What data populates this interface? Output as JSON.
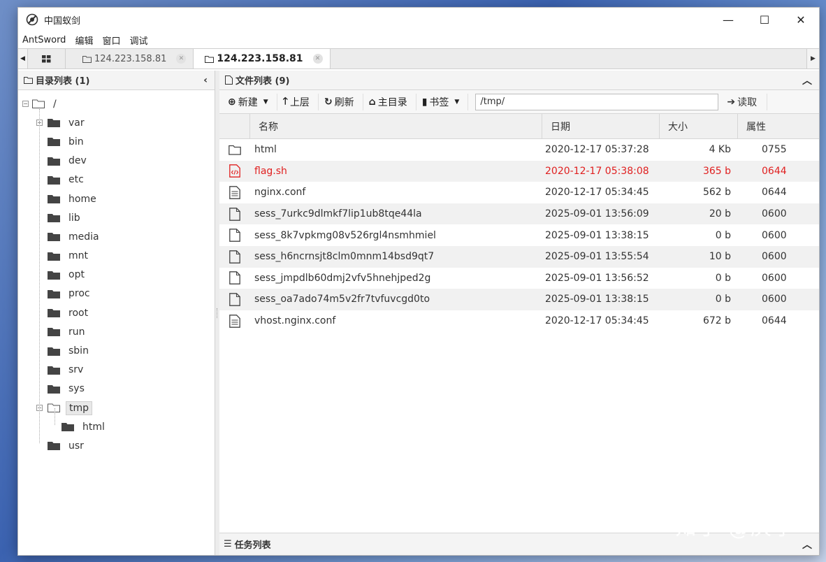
{
  "window": {
    "title": "中国蚁剑",
    "controls": {
      "minimize": "—",
      "maximize": "☐",
      "close": "✕"
    }
  },
  "menu": [
    "AntSword",
    "编辑",
    "窗口",
    "调试"
  ],
  "tabs": [
    {
      "label": "124.223.158.81",
      "active": false
    },
    {
      "label": "124.223.158.81",
      "active": true
    }
  ],
  "dir_panel": {
    "title": "目录列表 (1)",
    "tree": [
      {
        "label": "/",
        "depth": 0,
        "toggle": "minus",
        "open": true
      },
      {
        "label": "var",
        "depth": 1,
        "toggle": "plus"
      },
      {
        "label": "bin",
        "depth": 1
      },
      {
        "label": "dev",
        "depth": 1
      },
      {
        "label": "etc",
        "depth": 1
      },
      {
        "label": "home",
        "depth": 1
      },
      {
        "label": "lib",
        "depth": 1
      },
      {
        "label": "media",
        "depth": 1
      },
      {
        "label": "mnt",
        "depth": 1
      },
      {
        "label": "opt",
        "depth": 1
      },
      {
        "label": "proc",
        "depth": 1
      },
      {
        "label": "root",
        "depth": 1
      },
      {
        "label": "run",
        "depth": 1
      },
      {
        "label": "sbin",
        "depth": 1
      },
      {
        "label": "srv",
        "depth": 1
      },
      {
        "label": "sys",
        "depth": 1
      },
      {
        "label": "tmp",
        "depth": 1,
        "toggle": "minus",
        "open": true,
        "selected": true
      },
      {
        "label": "html",
        "depth": 2
      },
      {
        "label": "usr",
        "depth": 1
      }
    ]
  },
  "file_panel": {
    "title": "文件列表 (9)",
    "toolbar": {
      "new": "新建",
      "up": "上层",
      "refresh": "刷新",
      "home": "主目录",
      "bookmark": "书签",
      "path": "/tmp/",
      "read": "读取"
    },
    "columns": {
      "name": "名称",
      "date": "日期",
      "size": "大小",
      "attr": "属性"
    },
    "files": [
      {
        "type": "folder",
        "name": "html",
        "date": "2020-12-17 05:37:28",
        "size": "4 Kb",
        "attr": "0755"
      },
      {
        "type": "script",
        "name": "flag.sh",
        "date": "2020-12-17 05:38:08",
        "size": "365 b",
        "attr": "0644",
        "highlight": true
      },
      {
        "type": "text",
        "name": "nginx.conf",
        "date": "2020-12-17 05:34:45",
        "size": "562 b",
        "attr": "0644"
      },
      {
        "type": "file",
        "name": "sess_7urkc9dlmkf7lip1ub8tqe44la",
        "date": "2025-09-01 13:56:09",
        "size": "20 b",
        "attr": "0600"
      },
      {
        "type": "file",
        "name": "sess_8k7vpkmg08v526rgl4nsmhmiel",
        "date": "2025-09-01 13:38:15",
        "size": "0 b",
        "attr": "0600"
      },
      {
        "type": "file",
        "name": "sess_h6ncrnsjt8clm0mnm14bsd9qt7",
        "date": "2025-09-01 13:55:54",
        "size": "10 b",
        "attr": "0600"
      },
      {
        "type": "file",
        "name": "sess_jmpdlb60dmj2vfv5hnehjped2g",
        "date": "2025-09-01 13:56:52",
        "size": "0 b",
        "attr": "0600"
      },
      {
        "type": "file",
        "name": "sess_oa7ado74m5v2fr7tvfuvcgd0to",
        "date": "2025-09-01 13:38:15",
        "size": "0 b",
        "attr": "0600"
      },
      {
        "type": "text",
        "name": "vhost.nginx.conf",
        "date": "2020-12-17 05:34:45",
        "size": "672 b",
        "attr": "0644"
      }
    ]
  },
  "task_panel": {
    "title": "任务列表"
  },
  "watermark": "知乎 @庆予",
  "colors": {
    "highlight": "#e02020",
    "accent": "#3b62b0"
  }
}
